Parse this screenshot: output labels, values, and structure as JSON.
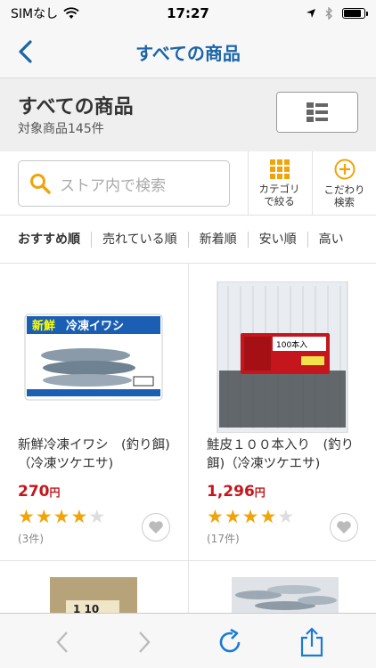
{
  "status_bar": {
    "carrier": "SIMなし",
    "time": "17:27"
  },
  "nav": {
    "title": "すべての商品"
  },
  "header": {
    "title": "すべての商品",
    "count": "対象商品145件"
  },
  "search": {
    "placeholder": "ストア内で検索"
  },
  "filters": {
    "category_line1": "カテゴリ",
    "category_line2": "で絞る",
    "detail_line1": "こだわり",
    "detail_line2": "検索"
  },
  "sort_tabs": [
    "おすすめ順",
    "売れている順",
    "新着順",
    "安い順",
    "高い"
  ],
  "products": [
    {
      "name": "新鮮冷凍イワシ　(釣り餌)（冷凍ツケエサ)",
      "price": "270",
      "currency": "円",
      "rating": 4,
      "reviews": "(3件)",
      "image_text_1": "新鮮",
      "image_text_2": "冷凍イワシ"
    },
    {
      "name": "鮭皮１００本入り　(釣り餌)（冷凍ツケエサ)",
      "price": "1,296",
      "currency": "円",
      "rating": 4,
      "reviews": "(17件)",
      "image_text_1": "100本入"
    }
  ],
  "products_row2": [
    {
      "image_text": "1  10"
    },
    {
      "image_text": ""
    }
  ],
  "icons": {
    "back": "chevron-left-icon",
    "list_view": "list-icon",
    "grid_view": "grid-icon",
    "search": "search-icon",
    "category": "grid-dots-icon",
    "detail": "plus-circle-icon",
    "favorite": "heart-icon",
    "toolbar_back": "chevron-left-icon",
    "toolbar_forward": "chevron-right-icon",
    "reload": "reload-icon",
    "share": "share-icon"
  },
  "colors": {
    "nav_title": "#1a64a8",
    "accent_orange": "#f0a40a",
    "price_red": "#c4161c"
  }
}
